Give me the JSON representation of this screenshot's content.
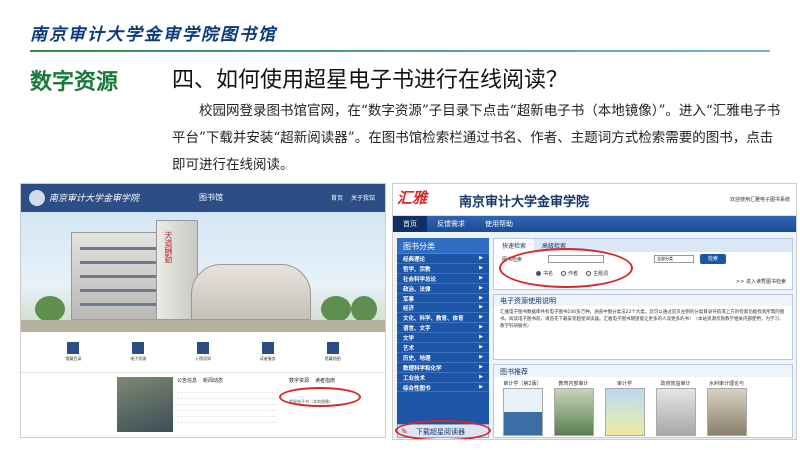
{
  "header": {
    "brand": "南京审计大学金审学院图书馆",
    "section": "数字资源"
  },
  "slide": {
    "title": "四、如何使用超星电子书进行在线阅读？",
    "paragraphs": [
      "校园网登录图书馆官网，在“数字资源”子目录下点击“超新电子书（本地镜像）”。进入“汇雅电子书平台”下载并安装“超新阅读器”。在图书馆检索栏通过书名、作者、主题词方式检索需要的图书，点击即可进行在线阅读。"
    ]
  },
  "left_screenshot": {
    "university": "南京审计大学金审学院",
    "library": "图书馆",
    "nav": [
      "首页",
      "关于我馆"
    ],
    "tower_text": "天道酬勤",
    "icons": [
      "馆藏目录",
      "电子资源",
      "入馆须知",
      "读者服务",
      "馆藏地图"
    ],
    "list_tabs": [
      "公告信息",
      "新闻动态"
    ],
    "right_tabs": [
      "数字资源",
      "读者指南"
    ],
    "highlighted_item": "超星电子书（本地镜像）"
  },
  "right_screenshot": {
    "logo": "汇雅",
    "site_title": "南京审计大学金审学院",
    "welcome": "欢迎使用汇雅电子图书系统",
    "nav": [
      "首页",
      "反馈需求",
      "使用帮助"
    ],
    "category_title": "图书分类",
    "categories": [
      "经典理论",
      "哲学、宗教",
      "社会科学总论",
      "政治、法律",
      "军事",
      "经济",
      "文化、科学、教育、体育",
      "语言、文字",
      "文学",
      "艺术",
      "历史、地理",
      "数理科学和化学",
      "工业技术",
      "综合性图书"
    ],
    "download_reader": "下载超星阅读器",
    "search_tabs": [
      "快速检索",
      "高级检索"
    ],
    "search_label": "图书检索",
    "search_select": "全部分类",
    "search_button": "检索",
    "radios": [
      "书名",
      "作者",
      "主题词"
    ],
    "entry_link": ">> 进入读秀图书检索",
    "info_title": "电子资源使用说明",
    "info_text": "汇雅电子图书数据库共有电子图书100多万种，涵盖中图分类法22个大类。您可以通过首页左侧的分类目录导航或上方的检索功能找到所需的图书。阅读电子图书前，请首先下载安装超星阅读器。汇雅电子图书期望能让更多的人读更多的书！（本站资源仅限教学相关内部使用，为学习、教学科研服务）",
    "rec_title": "图书推荐",
    "books": [
      "审计学（第2版）",
      "教育内部审计",
      "审计学",
      "政府效益审计",
      "水利审计理论与"
    ]
  }
}
